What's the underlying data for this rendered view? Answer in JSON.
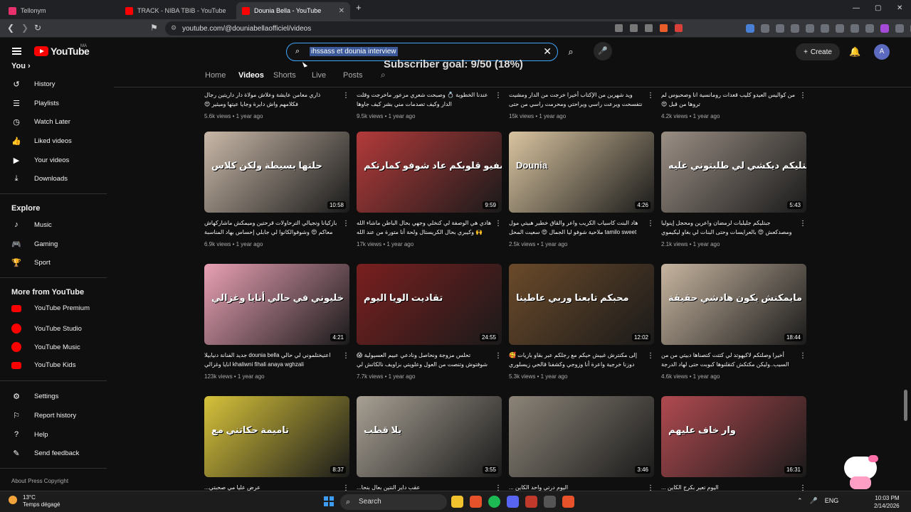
{
  "browser": {
    "tabs": [
      {
        "title": "Tellonym",
        "color": "#e7306c"
      },
      {
        "title": "TRACK - NIBA TBIB - YouTube",
        "color": "#ff0000"
      },
      {
        "title": "Dounia Bella - YouTube",
        "color": "#ff0000"
      }
    ],
    "url": "youtube.com/@douniabellaofficiel/videos"
  },
  "youtube": {
    "logo_text": "YouTube",
    "country": "MA",
    "search_value": "ihssass et dounia interview",
    "create_label": "Create",
    "avatar_letter": "A",
    "subscriber_goal": "Subscriber goal: 9/50 (18%)"
  },
  "sidebar": {
    "you_label": "You",
    "you_items": [
      {
        "label": "History",
        "icon": "history-icon"
      },
      {
        "label": "Playlists",
        "icon": "playlists-icon"
      },
      {
        "label": "Watch Later",
        "icon": "clock-icon"
      },
      {
        "label": "Liked videos",
        "icon": "thumbs-up-icon"
      },
      {
        "label": "Your videos",
        "icon": "video-icon"
      },
      {
        "label": "Downloads",
        "icon": "download-icon"
      }
    ],
    "explore_heading": "Explore",
    "explore_items": [
      {
        "label": "Music",
        "icon": "music-icon"
      },
      {
        "label": "Gaming",
        "icon": "gaming-icon"
      },
      {
        "label": "Sport",
        "icon": "trophy-icon"
      }
    ],
    "more_heading": "More from YouTube",
    "more_items": [
      {
        "label": "YouTube Premium"
      },
      {
        "label": "YouTube Studio"
      },
      {
        "label": "YouTube Music"
      },
      {
        "label": "YouTube Kids"
      }
    ],
    "settings_items": [
      {
        "label": "Settings",
        "icon": "gear-icon"
      },
      {
        "label": "Report history",
        "icon": "flag-icon"
      },
      {
        "label": "Help",
        "icon": "help-icon"
      },
      {
        "label": "Send feedback",
        "icon": "feedback-icon"
      }
    ],
    "footer": "About  Press  Copyright"
  },
  "channel_tabs": [
    "Home",
    "Videos",
    "Shorts",
    "Live",
    "Posts"
  ],
  "videos": [
    {
      "title": "ذاري معامن عايشة وعلاش مولاة دار داريتين رجال فكلامهم واش دايرة وجايا عيتها وميثير 😍",
      "views": "5.6k views",
      "age": "1 year ago",
      "duration": "",
      "thumb": "#3b2b25",
      "overlay": ""
    },
    {
      "title": "عندنا الخطوبة 💍 وصبحت شعري مزعور ماخرجت وقلت الدار وكيف تصدمات مني بشر كيف جاوها",
      "views": "9.5k views",
      "age": "1 year ago",
      "duration": "",
      "thumb": "#4a3a30",
      "overlay": ""
    },
    {
      "title": "ويد شهرين من الإكتاب أخيرا خرجت من الدار ومشيت نتفسحت ويرعت راسي ويراحتي ومحرمت راسي من حتى حاجة 😍",
      "views": "15k views",
      "age": "1 year ago",
      "duration": "",
      "thumb": "#2f2a28",
      "overlay": ""
    },
    {
      "title": "من كواليس العيدو كليب قعدات رومانسية انا وصحبوس لم تروها من قبل 😍",
      "views": "4.2k views",
      "age": "1 year ago",
      "duration": "",
      "thumb": "#3a3433",
      "overlay": ""
    },
    {
      "title": "بازكيانا ونجيالي الترحاولات قرحتين وميمكش ماشاركهاش معاكم 😍 وشوفوالكانوا لي جابلي إحساس بهاد المناسبة",
      "views": "6.9k views",
      "age": "1 year ago",
      "duration": "10:58",
      "thumb": "#c9b8a8",
      "overlay": "حلتها بسيطة ولكن كلاس"
    },
    {
      "title": "هادي هي الوصفة لي كنخلي وجهي بحال الباطن ماشاء الله 🙌 وكيبري بحال الكريستال ولحة أنا متورة من عند الله",
      "views": "17k views",
      "age": "1 year ago",
      "duration": "9:59",
      "thumb": "#b33a3a",
      "overlay": "صفيو قلوبكم عاد شوفو كمارتكم"
    },
    {
      "title": "هاد البنت كاسياب الكريب واعر والقاق خطير هبيتي مول tamilo sweet ملاحية شوفو ليا الجمال 😍 سعيت المحل",
      "views": "2.5k views",
      "age": "1 year ago",
      "duration": "4:26",
      "thumb": "#d9c4a0",
      "overlay": "Dounia"
    },
    {
      "title": "جبتليكم جليلبات لرمضان واعرين ومحجل إينوليا ومصدكعش 😍 بالعرايسات وحتى البنات لي بغاو ليكيموي",
      "views": "2.1k views",
      "age": "1 year ago",
      "duration": "5:43",
      "thumb": "#9a8e84",
      "overlay": "جبتليكم ديكشي لي طلبتوني عليه"
    },
    {
      "title": "اعتيختلموني لي حالي dounia bella جديد الفنانة دنيابيلا khaliwni fihali anaya wghzali انايا وغزالي",
      "views": "123k views",
      "age": "1 year ago",
      "duration": "4:21",
      "thumb": "#e8a0b4",
      "overlay": "خليوني في حالي أنايا وغزالي"
    },
    {
      "title": "تحلس مزوجة ونحاصل ونادعي عبيم العسيولية 😱 شوفتوش وتنصت من العول وعلويتي بزاويف نالكاتش لي جبت للوكزاي",
      "views": "7.7k views",
      "age": "1 year ago",
      "duration": "24:55",
      "thumb": "#7a1f1f",
      "overlay": "تقاديت الويا اليوم"
    },
    {
      "title": "إلى مكنترش غبيش حيكم مع رجلكم عبر بقاو بازيات 🥰 دوزنا خرجية واعرة أنا وزوجي وكشفنا قالحي زيسلوري",
      "views": "5.3k views",
      "age": "1 year ago",
      "duration": "12:02",
      "thumb": "#6b4a2a",
      "overlay": "محبكم تابعنا وربي عاطينا"
    },
    {
      "title": "أخيرا وصلتكم لاكيهوتد لي كتتت كتصناها دبيتي من من السيب..وليكن مكتكش كتقلنوها كبوبت حتى لهاد الدرجة 😱",
      "views": "4.6k views",
      "age": "1 year ago",
      "duration": "18:44",
      "thumb": "#c7b5a0",
      "overlay": "مايمكنش يكون هادشي حقيقة"
    },
    {
      "title": "عرض عليا مي صحبتي...",
      "views": "",
      "age": "",
      "duration": "8:37",
      "thumb": "#d6c23a",
      "overlay": "تاميمة حكاتني مع"
    },
    {
      "title": "عقب داير النتين بعال بنحا...",
      "views": "",
      "age": "",
      "duration": "3:55",
      "thumb": "#a8a094",
      "overlay": "يلا قطب"
    },
    {
      "title": "اليوم درتي واحد الكاين ...",
      "views": "",
      "age": "",
      "duration": "3:46",
      "thumb": "#8c8478",
      "overlay": ""
    },
    {
      "title": "اليوم تعير بكرج الكاين ...",
      "views": "",
      "age": "",
      "duration": "16:31",
      "thumb": "#b04a50",
      "overlay": "وار خاف عليهم"
    }
  ],
  "taskbar": {
    "temp": "13°C",
    "weather": "Temps dégagé",
    "search_label": "Search",
    "lang": "ENG",
    "time": "10:03 PM",
    "date": "2/14/2026"
  }
}
